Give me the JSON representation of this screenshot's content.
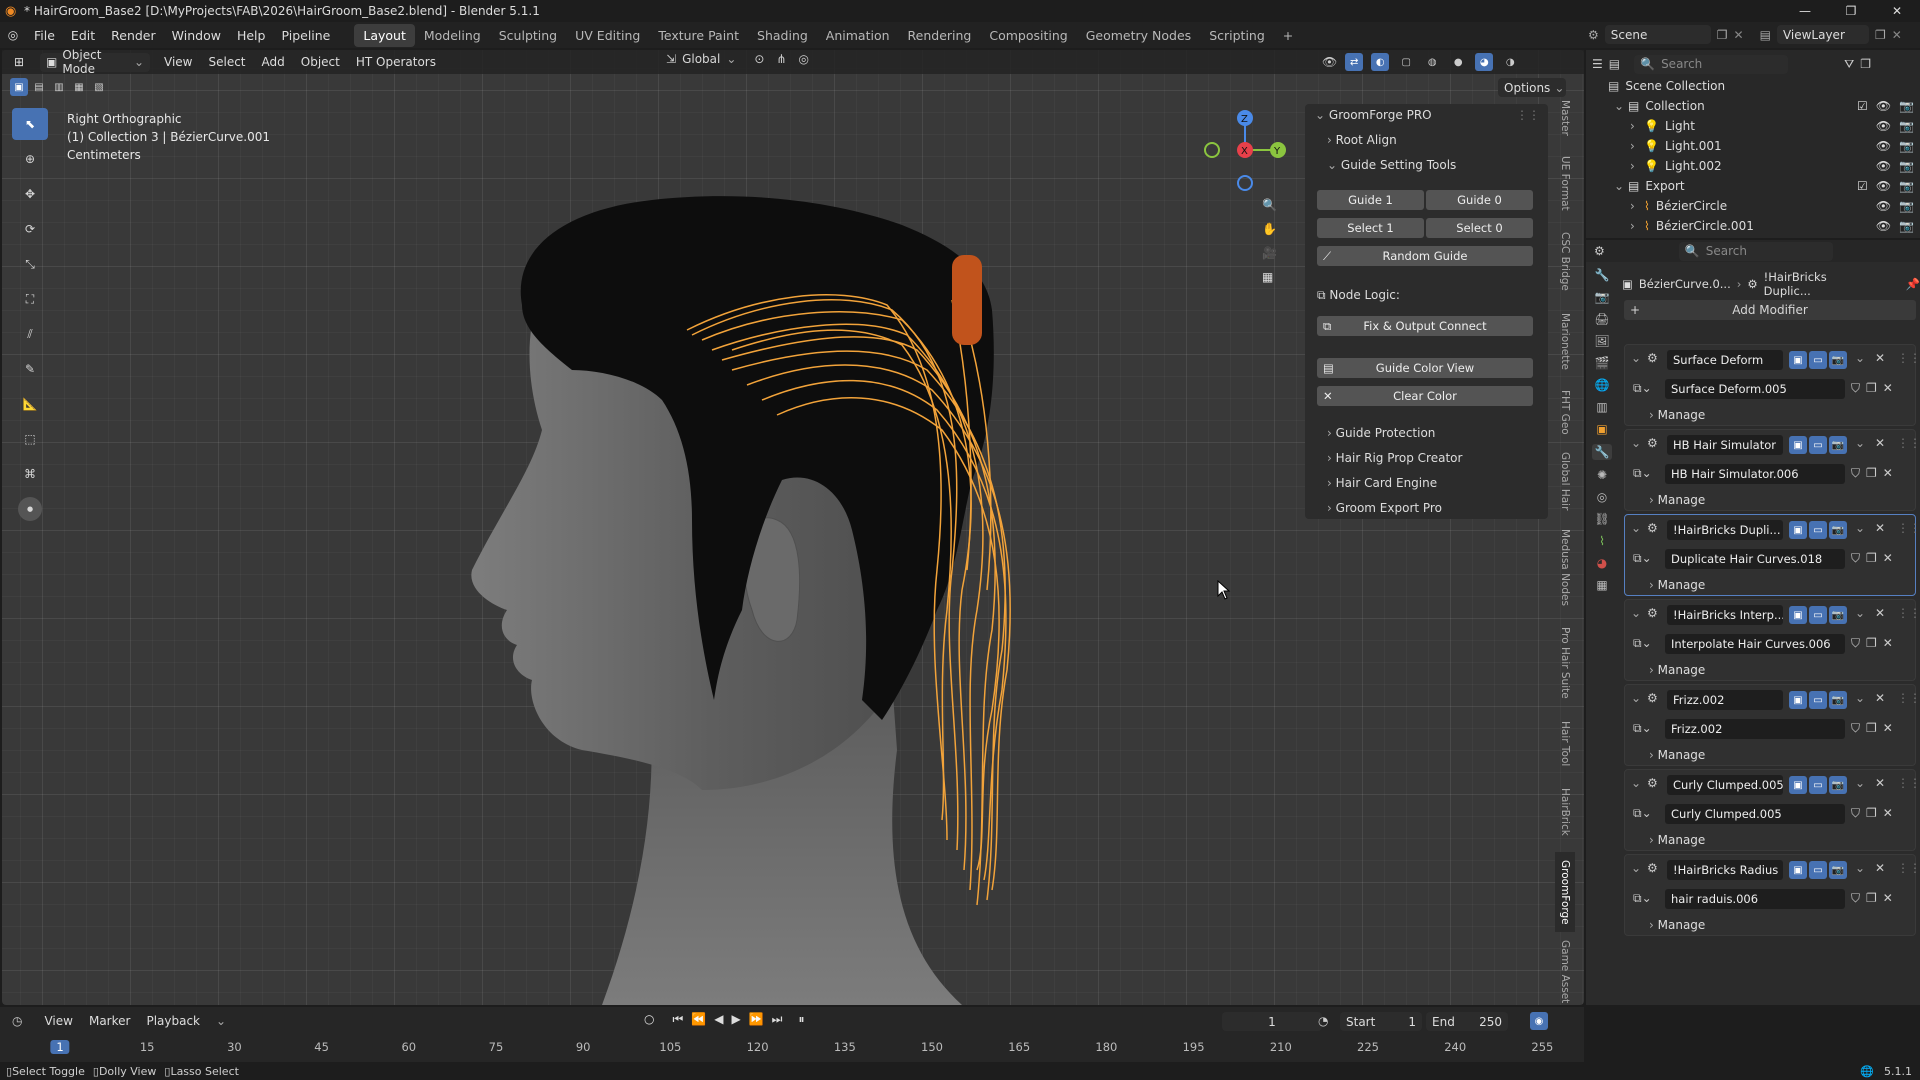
{
  "window": {
    "title": "* HairGroom_Base2 [D:\\MyProjects\\FAB\\2026\\HairGroom_Base2.blend] - Blender 5.1.1"
  },
  "topbar": {
    "menus": [
      "File",
      "Edit",
      "Render",
      "Window",
      "Help",
      "Pipeline"
    ],
    "workspaces": [
      "Layout",
      "Modeling",
      "Sculpting",
      "UV Editing",
      "Texture Paint",
      "Shading",
      "Animation",
      "Rendering",
      "Compositing",
      "Geometry Nodes",
      "Scripting"
    ],
    "active_workspace": "Layout",
    "scene": "Scene",
    "view_layer": "ViewLayer"
  },
  "viewport": {
    "mode": "Object Mode",
    "menus": [
      "View",
      "Select",
      "Add",
      "Object",
      "HT Operators"
    ],
    "orientation": "Global",
    "options": "Options",
    "overlay_lines": [
      "Right Orthographic",
      "(1) Collection 3 | BézierCurve.001",
      "Centimeters"
    ]
  },
  "npanel": {
    "title": "GroomForge PRO",
    "root_align": "Root Align",
    "guide_setting_tools": "Guide Setting Tools",
    "guide1": "Guide 1",
    "guide0": "Guide 0",
    "select1": "Select 1",
    "select0": "Select 0",
    "random_guide": "Random Guide",
    "node_logic": "Node Logic:",
    "fix_output": "Fix & Output Connect",
    "guide_color_view": "Guide Color View",
    "clear_color": "Clear Color",
    "sections": [
      "Guide Protection",
      "Hair Rig Prop Creator",
      "Hair Card Engine",
      "Groom Export Pro"
    ]
  },
  "side_tabs": [
    "Master",
    "UE Format",
    "CSC Bridge",
    "Marionette",
    "FHT Geo",
    "Global Hair",
    "Medusa Nodes",
    "Pro Hair Suite",
    "Hair Tool",
    "HairBrick",
    "GroomForge",
    "Game Asset"
  ],
  "outliner": {
    "search_placeholder": "Search",
    "scene_collection": "Scene Collection",
    "rows": [
      {
        "label": "Collection",
        "kind": "collection",
        "indent": 1
      },
      {
        "label": "Light",
        "kind": "light",
        "indent": 2
      },
      {
        "label": "Light.001",
        "kind": "light",
        "indent": 2
      },
      {
        "label": "Light.002",
        "kind": "light",
        "indent": 2
      },
      {
        "label": "Export",
        "kind": "collection",
        "indent": 1
      },
      {
        "label": "BézierCircle",
        "kind": "curve",
        "indent": 2
      },
      {
        "label": "BézierCircle.001",
        "kind": "curve",
        "indent": 2
      }
    ]
  },
  "properties": {
    "search_placeholder": "Search",
    "breadcrumb_object": "BézierCurve.0...",
    "breadcrumb_modifier": "!HairBricks Duplic...",
    "add_modifier": "Add Modifier",
    "manage": "Manage",
    "modifiers": [
      {
        "name": "Surface Deform",
        "nodegroup": "Surface Deform.005",
        "selected": false
      },
      {
        "name": "HB Hair Simulator",
        "nodegroup": "HB Hair Simulator.006",
        "selected": false
      },
      {
        "name": "!HairBricks Dupli...",
        "nodegroup": "Duplicate Hair Curves.018",
        "selected": true
      },
      {
        "name": "!HairBricks Interp...",
        "nodegroup": "Interpolate Hair Curves.006",
        "selected": false
      },
      {
        "name": "Frizz.002",
        "nodegroup": "Frizz.002",
        "selected": false
      },
      {
        "name": "Curly Clumped.005",
        "nodegroup": "Curly Clumped.005",
        "selected": false
      },
      {
        "name": "!HairBricks Radius",
        "nodegroup": "hair raduis.006",
        "selected": false
      }
    ]
  },
  "timeline": {
    "menus": [
      "View",
      "Marker",
      "Playback"
    ],
    "current_frame": "1",
    "start_label": "Start",
    "start": "1",
    "end_label": "End",
    "end": "250",
    "ticks": [
      "1",
      "15",
      "30",
      "45",
      "60",
      "75",
      "90",
      "105",
      "120",
      "135",
      "150",
      "165",
      "180",
      "195",
      "210",
      "225",
      "240",
      "255"
    ]
  },
  "statusbar": {
    "items": [
      "Select Toggle",
      "Dolly View",
      "Lasso Select"
    ],
    "version": "5.1.1"
  },
  "colors": {
    "accent": "#4772b3",
    "curve_selected": "#f2a33a",
    "gizmo_x": "#e8404a",
    "gizmo_y": "#8bc53f",
    "gizmo_z": "#4a8ae8"
  }
}
